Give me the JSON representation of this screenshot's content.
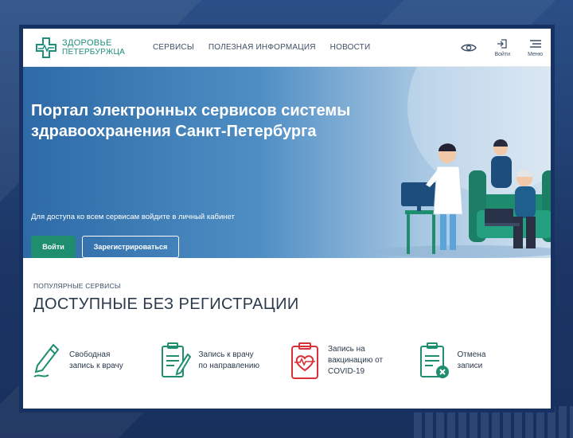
{
  "logo": {
    "line1": "ЗДОРОВЬЕ",
    "line2": "ПЕТЕРБУРЖЦА"
  },
  "nav": [
    {
      "label": "СЕРВИСЫ"
    },
    {
      "label": "ПОЛЕЗНАЯ ИНФОРМАЦИЯ"
    },
    {
      "label": "НОВОСТИ"
    }
  ],
  "header_actions": {
    "login_label": "Войти",
    "menu_label": "Меню"
  },
  "hero": {
    "title": "Портал электронных сервисов системы здравоохранения Санкт-Петербурга",
    "subtitle": "Для доступа ко всем сервисам войдите в личный кабинет",
    "login_button": "Войти",
    "register_button": "Зарегистрироваться"
  },
  "popular": {
    "kicker": "ПОПУЛЯРНЫЕ СЕРВИСЫ",
    "title": "ДОСТУПНЫЕ БЕЗ РЕГИСТРАЦИИ",
    "services": [
      {
        "label": "Свободная\nзапись к врачу",
        "icon": "pen-icon"
      },
      {
        "label": "Запись к врачу\nпо направлению",
        "icon": "clipboard-pen-icon"
      },
      {
        "label": "Запись на\nвакцинацию от\nCOVID-19",
        "icon": "clipboard-heart-icon"
      },
      {
        "label": "Отмена\nзаписи",
        "icon": "document-cancel-icon"
      }
    ]
  },
  "colors": {
    "brand_green": "#1f8e6f",
    "frame": "#173262",
    "covid_red": "#d9313a",
    "text": "#2b3a4d"
  }
}
